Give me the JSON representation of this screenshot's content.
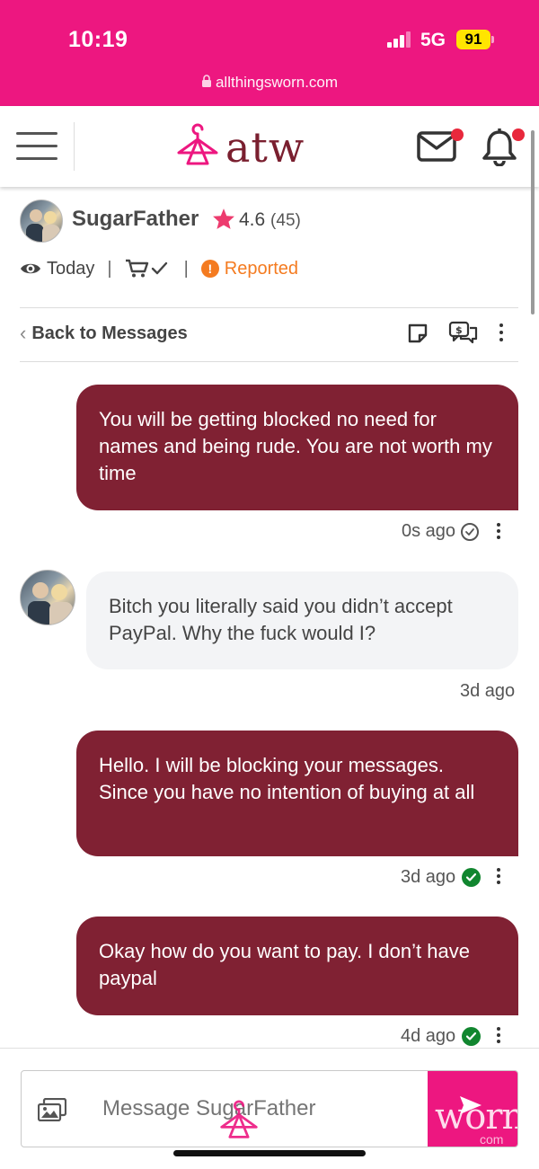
{
  "status_bar": {
    "time": "10:19",
    "network": "5G",
    "battery": "91",
    "url": "allthingsworn.com"
  },
  "header": {
    "logo_text": "atw",
    "brand_color": "#ed1780",
    "logo_color": "#7a1f2f",
    "icons": [
      "menu-icon",
      "hanger-icon",
      "mail-icon",
      "bell-icon"
    ],
    "mail_has_badge": true,
    "bell_has_badge": true
  },
  "profile": {
    "name": "SugarFather",
    "rating": "4.6",
    "rating_count": "(45)",
    "last_seen": "Today",
    "status": "Reported",
    "status_color": "#f47b20"
  },
  "toolbar": {
    "back_label": "Back to Messages",
    "icons": [
      "note-icon",
      "payment-chat-icon",
      "more-icon"
    ]
  },
  "messages": [
    {
      "direction": "sent",
      "text": "You will be getting blocked no need for names and being rude. You are not worth my time",
      "time": "0s ago",
      "status": "sent"
    },
    {
      "direction": "received",
      "text": "Bitch you literally said you didn’t accept PayPal. Why the fuck would I?",
      "time": "3d ago"
    },
    {
      "direction": "sent",
      "text": "Hello. I will be blocking your messages. Since you have no intention of buying at all",
      "time": "3d ago",
      "status": "read"
    },
    {
      "direction": "sent",
      "text": "Okay how do you want to pay. I don’t have paypal",
      "time": "4d ago",
      "status": "read"
    }
  ],
  "composer": {
    "placeholder": "Message SugarFather",
    "watermark": "worn",
    "watermark_sub": "com"
  },
  "colors": {
    "sent_bubble": "#802133",
    "received_bubble": "#f3f4f6",
    "read_check": "#11862f"
  }
}
